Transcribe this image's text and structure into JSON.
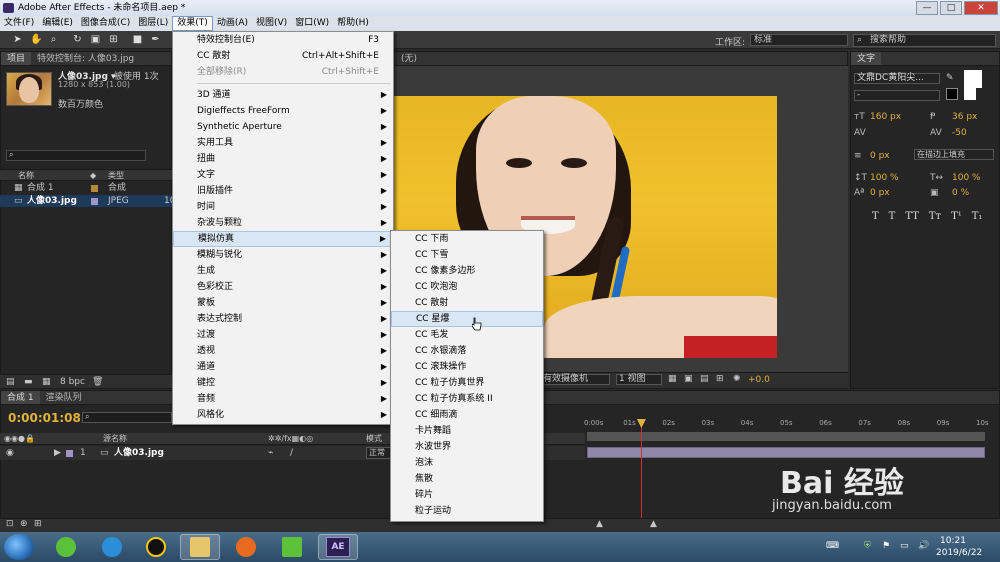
{
  "window": {
    "title": "Adobe After Effects - 未命名项目.aep *",
    "controls": [
      "—",
      "□",
      "✕"
    ]
  },
  "menubar": [
    "文件(F)",
    "编辑(E)",
    "图像合成(C)",
    "图层(L)",
    "效果(T)",
    "动画(A)",
    "视图(V)",
    "窗口(W)",
    "帮助(H)"
  ],
  "toolbar": {
    "workspace_label": "工作区:",
    "workspace_value": "标准",
    "search_help": "搜索帮助"
  },
  "project": {
    "tabs": [
      "项目",
      "特效控制台: 人像03.jpg"
    ],
    "item_name": "人像03.jpg ▾",
    "item_used": "被使用 1次",
    "item_dims": "1280 x 853 (1.00)",
    "item_colors": "数百万颜色",
    "col_name": "名称",
    "col_type": "类型",
    "rows": [
      {
        "name": "合成 1",
        "type": "合成",
        "color": "#b48a3a"
      },
      {
        "name": "人像03.jpg",
        "type": "JPEG",
        "color": "#9f95c8",
        "size": "10"
      }
    ],
    "bpc": "8 bpc"
  },
  "viewer": {
    "tab_label": "(无)",
    "camera": "有效摄像机",
    "views": "1 视图",
    "exposure": "+0.0"
  },
  "text_panel": {
    "tab": "文字",
    "font": "文鼎DC黄阳尖...",
    "font_style": "-",
    "size": "160 px",
    "leading": "36 px",
    "tracking": "-50",
    "stroke": "0 px",
    "stroke_mode": "在描边上填充",
    "vscale": "100 %",
    "hscale": "100 %",
    "baseline": "0 px",
    "tsume": "0 %",
    "styles": [
      "T",
      "T",
      "TT",
      "Tт",
      "T¹",
      "T₁"
    ]
  },
  "timeline": {
    "tabs": [
      "合成 1",
      "渲染队列"
    ],
    "time": "0:00:01:08",
    "col_source": "源名称",
    "col_mode": "模式",
    "layer_num": "1",
    "layer_name": "人像03.jpg",
    "layer_mode": "正常",
    "ticks": [
      "0:00s",
      "01s",
      "02s",
      "03s",
      "04s",
      "05s",
      "06s",
      "07s",
      "08s",
      "09s",
      "10s"
    ],
    "playhead_seconds": 1.35
  },
  "effects_menu": [
    {
      "label": "特效控制台(E)",
      "shortcut": "F3"
    },
    {
      "label": "CC 散射",
      "shortcut": "Ctrl+Alt+Shift+E"
    },
    {
      "label": "全部移除(R)",
      "shortcut": "Ctrl+Shift+E",
      "disabled": true
    },
    {
      "sep": true
    },
    {
      "label": "3D 通道",
      "sub": true
    },
    {
      "label": "Digieffects FreeForm",
      "sub": true
    },
    {
      "label": "Synthetic Aperture",
      "sub": true
    },
    {
      "label": "实用工具",
      "sub": true
    },
    {
      "label": "扭曲",
      "sub": true
    },
    {
      "label": "文字",
      "sub": true
    },
    {
      "label": "旧版插件",
      "sub": true
    },
    {
      "label": "时间",
      "sub": true
    },
    {
      "label": "杂波与颗粒",
      "sub": true
    },
    {
      "label": "模拟仿真",
      "sub": true,
      "highlight": true
    },
    {
      "label": "模糊与锐化",
      "sub": true
    },
    {
      "label": "生成",
      "sub": true
    },
    {
      "label": "色彩校正",
      "sub": true
    },
    {
      "label": "蒙板",
      "sub": true
    },
    {
      "label": "表达式控制",
      "sub": true
    },
    {
      "label": "过渡",
      "sub": true
    },
    {
      "label": "透视",
      "sub": true
    },
    {
      "label": "通道",
      "sub": true
    },
    {
      "label": "键控",
      "sub": true
    },
    {
      "label": "音频",
      "sub": true
    },
    {
      "label": "风格化",
      "sub": true
    }
  ],
  "simulation_menu": [
    {
      "label": "CC 下雨"
    },
    {
      "label": "CC 下雪"
    },
    {
      "label": "CC 像素多边形"
    },
    {
      "label": "CC 吹泡泡"
    },
    {
      "label": "CC 散射"
    },
    {
      "label": "CC 星爆",
      "highlight": true
    },
    {
      "label": "CC 毛发"
    },
    {
      "label": "CC 水银滴落"
    },
    {
      "label": "CC 滚珠操作"
    },
    {
      "label": "CC 粒子仿真世界"
    },
    {
      "label": "CC 粒子仿真系统 II"
    },
    {
      "label": "CC 细雨滴"
    },
    {
      "label": "卡片舞蹈"
    },
    {
      "label": "水波世界"
    },
    {
      "label": "泡沫"
    },
    {
      "label": "焦散"
    },
    {
      "label": "碎片"
    },
    {
      "label": "粒子运动"
    }
  ],
  "taskbar": {
    "time": "10:21",
    "date": "2019/6/22",
    "ae_label": "AE"
  },
  "watermark": {
    "brand": "Bai 经验",
    "url": "jingyan.baidu.com"
  }
}
